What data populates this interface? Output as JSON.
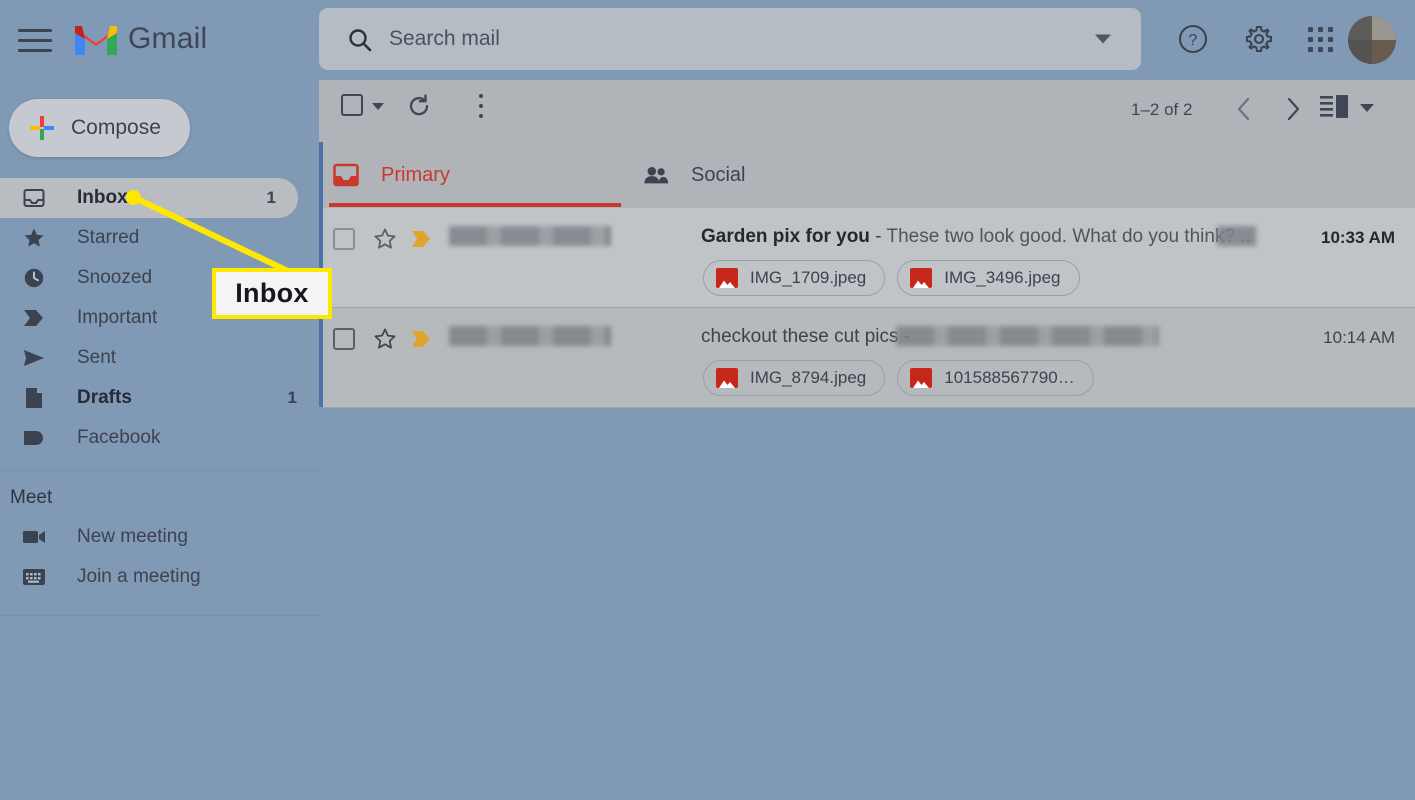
{
  "app": {
    "name": "Gmail"
  },
  "header": {
    "menu_icon": "hamburger-menu-icon",
    "logo_icon": "gmail-logo-icon",
    "brand": "Gmail",
    "search": {
      "placeholder": "Search mail",
      "value": "",
      "icon": "search-icon",
      "options_icon": "chevron-down-icon"
    },
    "help_icon": "help-circle-icon",
    "settings_icon": "gear-icon",
    "apps_icon": "apps-grid-icon",
    "avatar_icon": "account-avatar"
  },
  "sidebar": {
    "compose": {
      "label": "Compose",
      "icon": "plus-icon"
    },
    "items": [
      {
        "label": "Inbox",
        "icon": "inbox-icon",
        "count": "1",
        "active": true
      },
      {
        "label": "Starred",
        "icon": "star-icon",
        "count": "",
        "active": false
      },
      {
        "label": "Snoozed",
        "icon": "clock-icon",
        "count": "",
        "active": false
      },
      {
        "label": "Important",
        "icon": "important-icon",
        "count": "",
        "active": false
      },
      {
        "label": "Sent",
        "icon": "send-icon",
        "count": "",
        "active": false
      },
      {
        "label": "Drafts",
        "icon": "draft-icon",
        "count": "1",
        "active": false
      },
      {
        "label": "Facebook",
        "icon": "label-icon",
        "count": "",
        "active": false
      }
    ],
    "meet": {
      "title": "Meet",
      "items": [
        {
          "label": "New meeting",
          "icon": "video-camera-icon"
        },
        {
          "label": "Join a meeting",
          "icon": "keyboard-icon"
        }
      ]
    }
  },
  "toolbar": {
    "select_all_checkbox": "select-all-checkbox",
    "select_caret": "chevron-down-icon",
    "refresh_icon": "refresh-icon",
    "more_icon": "more-options-icon",
    "pager_count": "1–2 of 2",
    "prev_icon": "chevron-left-icon",
    "next_icon": "chevron-right-icon",
    "split_pane_icon": "split-pane-icon",
    "split_pane_caret": "chevron-down-icon"
  },
  "tabs": [
    {
      "label": "Primary",
      "icon": "inbox-tab-icon",
      "selected": true
    },
    {
      "label": "Social",
      "icon": "people-icon",
      "selected": false
    }
  ],
  "emails": [
    {
      "unread": true,
      "sender": "",
      "subject": "Garden pix for you",
      "separator": " - ",
      "snippet": "These two look good. What do you think? ..",
      "time": "10:33 AM",
      "star_icon": "star-outline-icon",
      "important_icon": "important-marker-icon",
      "attachments": [
        {
          "name": "IMG_1709.jpeg",
          "icon": "image-file-icon"
        },
        {
          "name": "IMG_3496.jpeg",
          "icon": "image-file-icon"
        }
      ]
    },
    {
      "unread": false,
      "sender": "",
      "subject": "checkout these cut pics",
      "separator": " - ",
      "snippet": "",
      "time": "10:14 AM",
      "star_icon": "star-outline-icon",
      "important_icon": "important-marker-icon",
      "attachments": [
        {
          "name": "IMG_8794.jpeg",
          "icon": "image-file-icon"
        },
        {
          "name": "101588567790…",
          "icon": "image-file-icon"
        }
      ]
    }
  ],
  "annotation": {
    "label": "Inbox",
    "target": "sidebar-item-inbox"
  },
  "colors": {
    "accent_red": "#c8392e",
    "annotation_yellow": "#ffe800",
    "list_accent_blue": "#4a74a8",
    "attachment_red": "#c5271d"
  }
}
